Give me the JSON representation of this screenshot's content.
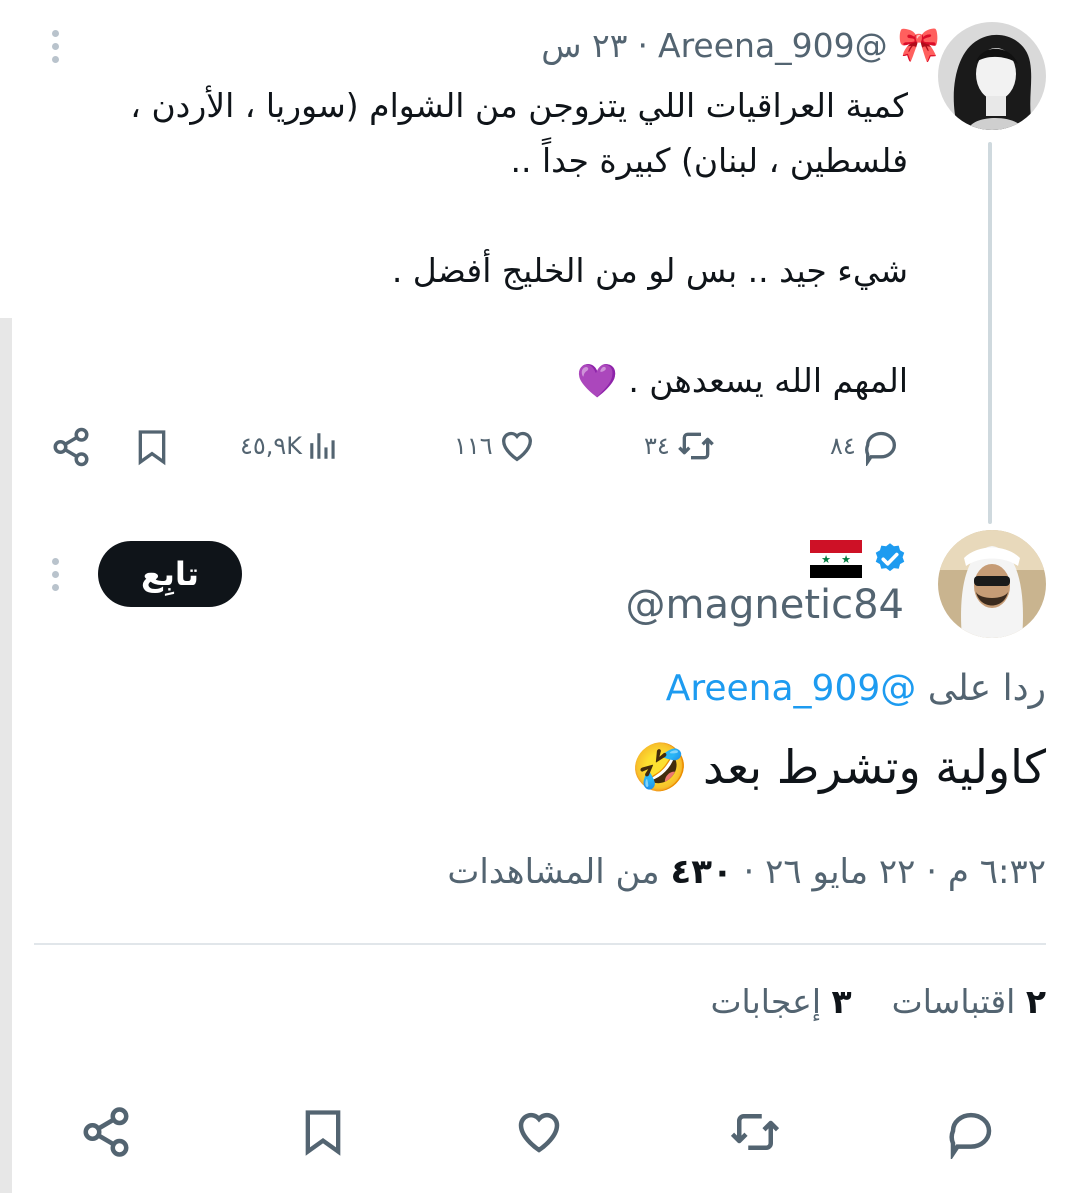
{
  "tweet1": {
    "handle": "@Areena_909",
    "bow": "🎀",
    "time": "٢٣ س",
    "separator": "·",
    "lines": [
      "كمية العراقيات اللي يتزوجن من الشوام (سوريا ، الأردن ،",
      "فلسطين ، لبنان) كبيرة جداً ..",
      "",
      "شيء جيد .. بس لو من الخليج أفضل .",
      "",
      "المهم الله يسعدهن . 💜"
    ],
    "replies": "٨٤",
    "retweets": "٣٤",
    "likes": "١١٦",
    "views": "٤٥,٩K"
  },
  "tweet2": {
    "follow_label": "تابِع",
    "flag": "🇸🇾",
    "handle": "@magnetic84",
    "reply_prefix": "ردا على",
    "reply_mention": "@Areena_909",
    "text": "كاولية وتشرط بعد 🤣",
    "time": "٦:٣٢ م",
    "date": "٢٢ مايو ٢٦",
    "separator": "·",
    "views_count": "٤٣٠",
    "views_label": "من المشاهدات",
    "quotes_count": "٢",
    "quotes_label": "اقتباسات",
    "likes_count": "٣",
    "likes_label": "إعجابات"
  },
  "colors": {
    "accent": "#1d9bf0",
    "muted": "#536471",
    "text": "#0f1419",
    "heart": "#9b4bd8"
  }
}
